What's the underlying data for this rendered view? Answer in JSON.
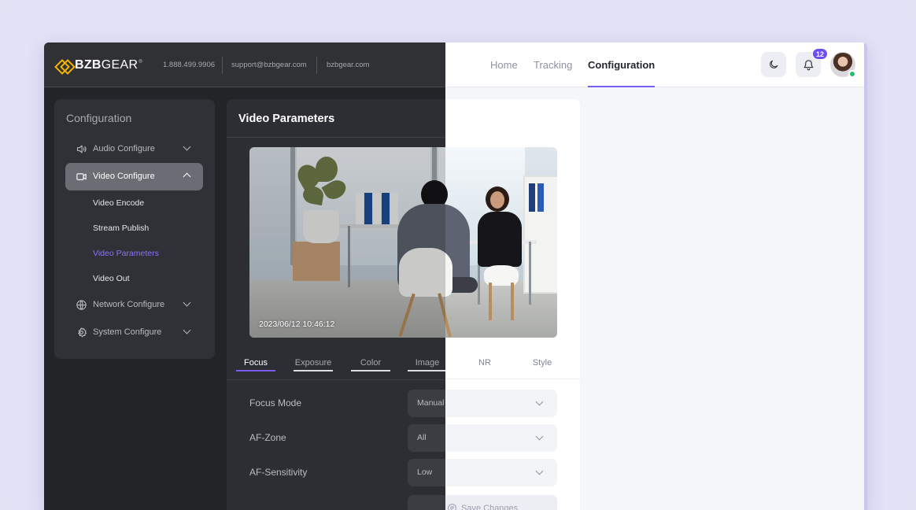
{
  "brand": {
    "logo_text_bold": "BZB",
    "logo_text_light": "GEAR",
    "logo_registered": "®",
    "phone": "1.888.499.9906",
    "email": "support@bzbgear.com",
    "website": "bzbgear.com"
  },
  "nav": {
    "links": [
      {
        "label": "Home"
      },
      {
        "label": "Tracking"
      },
      {
        "label": "Configuration"
      }
    ],
    "active": "Configuration",
    "notifications_count": "12"
  },
  "sidebar": {
    "title": "Configuration",
    "items": [
      {
        "label": "Audio Configure",
        "icon": "speaker-icon"
      },
      {
        "label": "Video Configure",
        "icon": "video-camera-icon"
      },
      {
        "label": "Network Configure",
        "icon": "globe-icon"
      },
      {
        "label": "System Configure",
        "icon": "gear-icon"
      }
    ],
    "subitems": [
      {
        "label": "Video Encode"
      },
      {
        "label": "Stream Publish"
      },
      {
        "label": "Video Parameters"
      },
      {
        "label": "Video Out"
      }
    ],
    "active_subitem": "Video Parameters"
  },
  "main": {
    "title": "Video Parameters",
    "preview_timestamp": "2023/06/12  10:46:12",
    "tabs": [
      {
        "label": "Focus"
      },
      {
        "label": "Exposure"
      },
      {
        "label": "Color"
      },
      {
        "label": "Image"
      },
      {
        "label": "NR"
      },
      {
        "label": "Style"
      }
    ],
    "active_tab": "Focus",
    "fields": [
      {
        "label": "Focus Mode",
        "value": "Manual"
      },
      {
        "label": "AF-Zone",
        "value": "All"
      },
      {
        "label": "AF-Sensitivity",
        "value": "Low"
      }
    ],
    "save_label": "Save Changes"
  },
  "colors": {
    "accent": "#7b5cf0",
    "dark_bg": "#232428",
    "brand_yellow": "#f4b400",
    "online": "#22c06b"
  }
}
